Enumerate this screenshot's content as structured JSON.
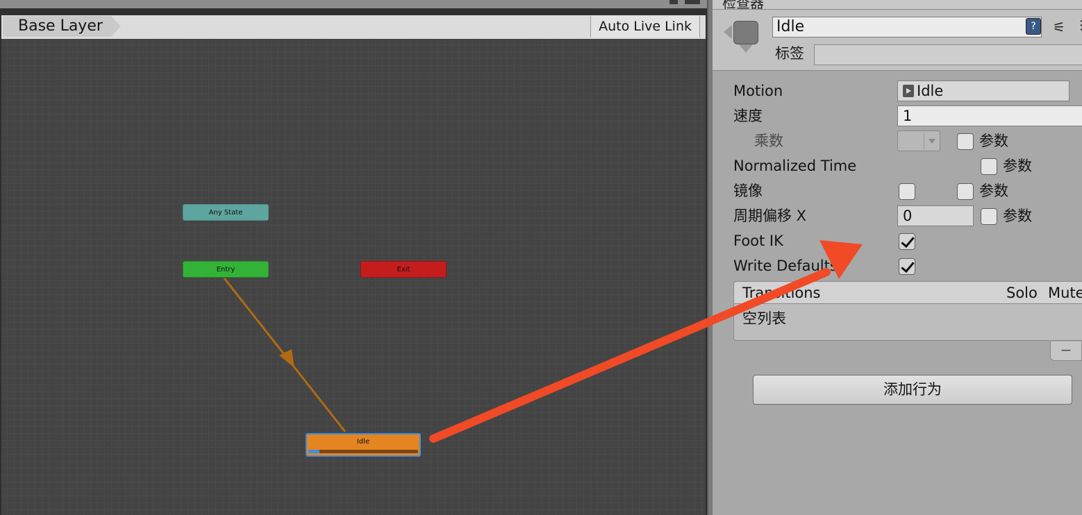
{
  "animator": {
    "breadcrumb": "Base Layer",
    "live_link": "Auto Live Link",
    "nodes": {
      "any_state": "Any State",
      "entry": "Entry",
      "exit": "Exit",
      "idle": "Idle"
    },
    "idle_progress": 0.1,
    "colors": {
      "any_state": "#5ea59f",
      "entry": "#33b237",
      "exit": "#c41d1d",
      "idle": "#e58522",
      "transition": "#b06b12",
      "annotation_arrow": "#f04a26"
    }
  },
  "inspector": {
    "tab_title": "检查器",
    "state_name": "Idle",
    "tag_label": "标签",
    "tag_value": "",
    "properties": {
      "motion_label": "Motion",
      "motion_value": "Idle",
      "speed_label": "速度",
      "speed_value": "1",
      "multiplier_label": "乘数",
      "normalized_time_label": "Normalized Time",
      "mirror_label": "镜像",
      "cycle_offset_label": "周期偏移 X",
      "cycle_offset_value": "0",
      "foot_ik_label": "Foot IK",
      "foot_ik_checked": true,
      "write_defaults_label": "Write Defaults",
      "write_defaults_checked": true,
      "param_label": "参数"
    },
    "transitions": {
      "title": "Transitions",
      "solo": "Solo",
      "mute": "Mute",
      "empty": "空列表"
    },
    "add_behaviour": "添加行为",
    "icons": [
      "state-icon",
      "help-icon",
      "settings-icon",
      "more-icon",
      "clip-icon",
      "dropdown-arrow-icon",
      "minus-icon"
    ]
  }
}
